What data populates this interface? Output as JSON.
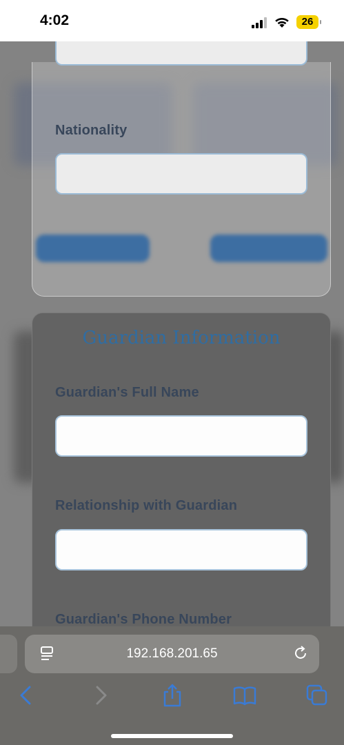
{
  "status_bar": {
    "time": "4:02",
    "battery": "26"
  },
  "form": {
    "nationality_label": "Nationality",
    "guardian_section_title": "Guardian Information",
    "guardian_name_label": "Guardian's Full Name",
    "relationship_label": "Relationship with Guardian",
    "guardian_phone_label": "Guardian's Phone Number"
  },
  "browser": {
    "url": "192.168.201.65"
  },
  "icons": [
    "signal-icon",
    "wifi-icon",
    "page-menu-icon",
    "reload-icon",
    "back-icon",
    "forward-icon",
    "share-icon",
    "bookmarks-icon",
    "tabs-icon"
  ],
  "colors": {
    "accent": "#2f6da3",
    "label": "#38465a",
    "battery": "#f5d100",
    "toolbar_icon": "#3a7bd5"
  }
}
